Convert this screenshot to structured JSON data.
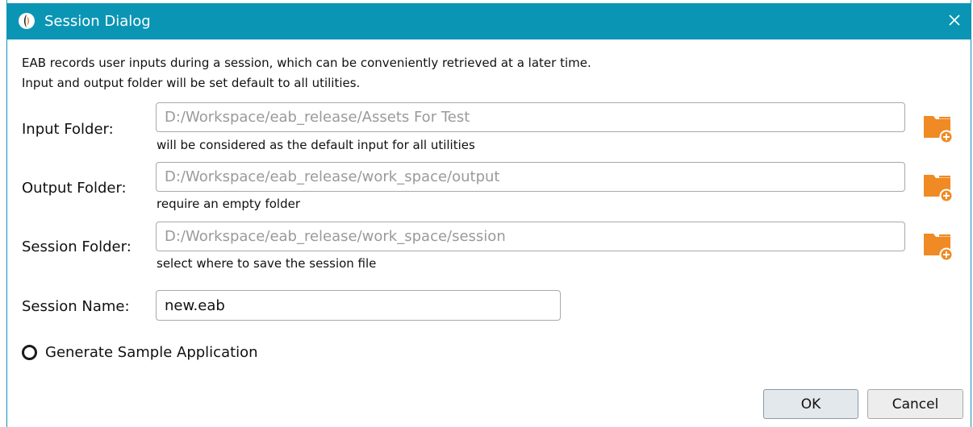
{
  "window": {
    "title": "Session Dialog",
    "app_icon": "app-logo-icon",
    "close_icon": "close-icon",
    "accent_color": "#0b95b5"
  },
  "intro": {
    "line1": "EAB records user inputs during a session, which can be conveniently retrieved at a later time.",
    "line2": "Input and output folder will be set default to all utilities."
  },
  "fields": {
    "input_folder": {
      "label": "Input Folder:",
      "placeholder": "D:/Workspace/eab_release/Assets For Test",
      "hint": "will be considered as the default input for all utilities",
      "button_icon": "folder-add-icon"
    },
    "output_folder": {
      "label": "Output Folder:",
      "placeholder": "D:/Workspace/eab_release/work_space/output",
      "hint": "require an empty folder",
      "button_icon": "folder-add-icon"
    },
    "session_folder": {
      "label": "Session Folder:",
      "placeholder": "D:/Workspace/eab_release/work_space/session",
      "hint": "select where to save the session file",
      "button_icon": "folder-add-icon"
    },
    "session_name": {
      "label": "Session Name:",
      "value": "new.eab"
    }
  },
  "options": {
    "generate_sample_label": "Generate Sample Application",
    "generate_sample_checked": false
  },
  "buttons": {
    "ok_label": "OK",
    "cancel_label": "Cancel"
  },
  "colors": {
    "folder_icon": "#f08a24"
  }
}
